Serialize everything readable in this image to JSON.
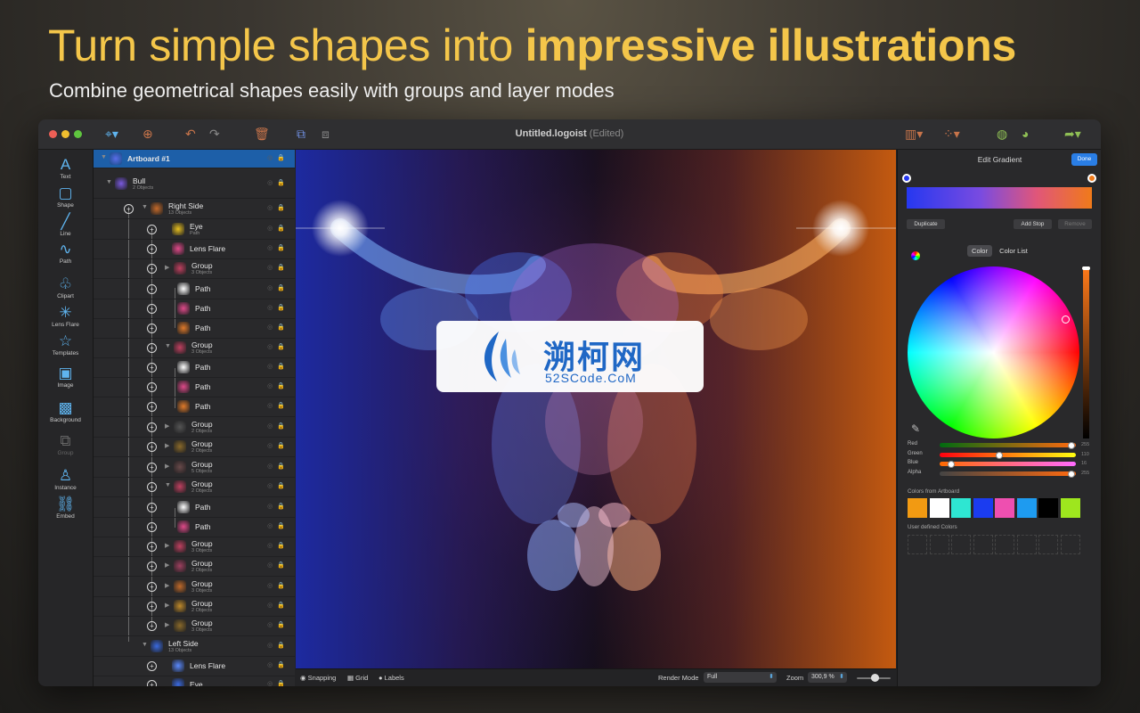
{
  "headline": {
    "part1": "Turn simple shapes into ",
    "part2": "impressive illustrations"
  },
  "subline": "Combine geometrical shapes easily with groups and layer modes",
  "window": {
    "title": "Untitled.logoist",
    "edited": "(Edited)"
  },
  "tools": [
    {
      "label": "Text",
      "icon": "text-icon",
      "glyph": "A"
    },
    {
      "label": "Shape",
      "icon": "shape-icon",
      "glyph": "▢"
    },
    {
      "label": "Line",
      "icon": "line-icon",
      "glyph": "╱"
    },
    {
      "label": "Path",
      "icon": "path-icon",
      "glyph": "∿"
    },
    {
      "label": "Clipart",
      "icon": "clipart-icon",
      "glyph": "♧"
    },
    {
      "label": "Lens Flare",
      "icon": "lens-flare-icon",
      "glyph": "✳"
    },
    {
      "label": "Templates",
      "icon": "templates-icon",
      "glyph": "☆"
    },
    {
      "label": "Image",
      "icon": "image-icon",
      "glyph": "▣"
    },
    {
      "label": "Background",
      "icon": "background-icon",
      "glyph": "▩"
    },
    {
      "label": "Group",
      "icon": "group-icon",
      "glyph": "⧉"
    },
    {
      "label": "Instance",
      "icon": "instance-icon",
      "glyph": "♙"
    },
    {
      "label": "Embed",
      "icon": "embed-icon",
      "glyph": "⛓"
    }
  ],
  "layers": [
    {
      "name": "Artboard #1",
      "sub": ""
    },
    {
      "name": "Bull",
      "sub": "2 Objects"
    },
    {
      "name": "Right Side",
      "sub": "13 Objects"
    },
    {
      "name": "Eye",
      "sub": "Path"
    },
    {
      "name": "Lens Flare",
      "sub": ""
    },
    {
      "name": "Group",
      "sub": "3 Objects"
    },
    {
      "name": "Path",
      "sub": ""
    },
    {
      "name": "Path",
      "sub": ""
    },
    {
      "name": "Path",
      "sub": ""
    },
    {
      "name": "Group",
      "sub": "3 Objects"
    },
    {
      "name": "Path",
      "sub": ""
    },
    {
      "name": "Path",
      "sub": ""
    },
    {
      "name": "Path",
      "sub": ""
    },
    {
      "name": "Group",
      "sub": "2 Objects"
    },
    {
      "name": "Group",
      "sub": "2 Objects"
    },
    {
      "name": "Group",
      "sub": "5 Objects"
    },
    {
      "name": "Group",
      "sub": "2 Objects"
    },
    {
      "name": "Path",
      "sub": ""
    },
    {
      "name": "Path",
      "sub": ""
    },
    {
      "name": "Group",
      "sub": "3 Objects"
    },
    {
      "name": "Group",
      "sub": "2 Objects"
    },
    {
      "name": "Group",
      "sub": "3 Objects"
    },
    {
      "name": "Group",
      "sub": "2 Objects"
    },
    {
      "name": "Group",
      "sub": "3 Objects"
    },
    {
      "name": "Left Side",
      "sub": "13 Objects"
    },
    {
      "name": "Lens Flare",
      "sub": ""
    },
    {
      "name": "Eye",
      "sub": ""
    }
  ],
  "statusbar": {
    "snapping": "Snapping",
    "grid": "Grid",
    "labels": "Labels",
    "render_label": "Render Mode",
    "render_value": "Full",
    "zoom_label": "Zoom",
    "zoom_value": "300,9 %"
  },
  "inspector": {
    "title": "Edit Gradient",
    "done": "Done",
    "duplicate": "Duplicate",
    "add_stop": "Add Stop",
    "remove": "Remove",
    "tab_color": "Color",
    "tab_color_list": "Color List",
    "sliders": [
      {
        "label": "Red",
        "value": "255",
        "pos": 0.98
      },
      {
        "label": "Green",
        "value": "110",
        "pos": 0.43
      },
      {
        "label": "Blue",
        "value": "16",
        "pos": 0.06
      },
      {
        "label": "Alpha",
        "value": "255",
        "pos": 0.98
      }
    ],
    "colors_from_artboard": "Colors from Artboard",
    "user_defined": "User defined Colors",
    "swatches": [
      "#f29a12",
      "#ffffff",
      "#2ee6d2",
      "#1b3cf0",
      "#ee4fb0",
      "#1e9bf0",
      "#000000",
      "#9ee61e"
    ]
  },
  "watermark": {
    "title": "溯柯网",
    "sub": "52SCode.CoM"
  }
}
